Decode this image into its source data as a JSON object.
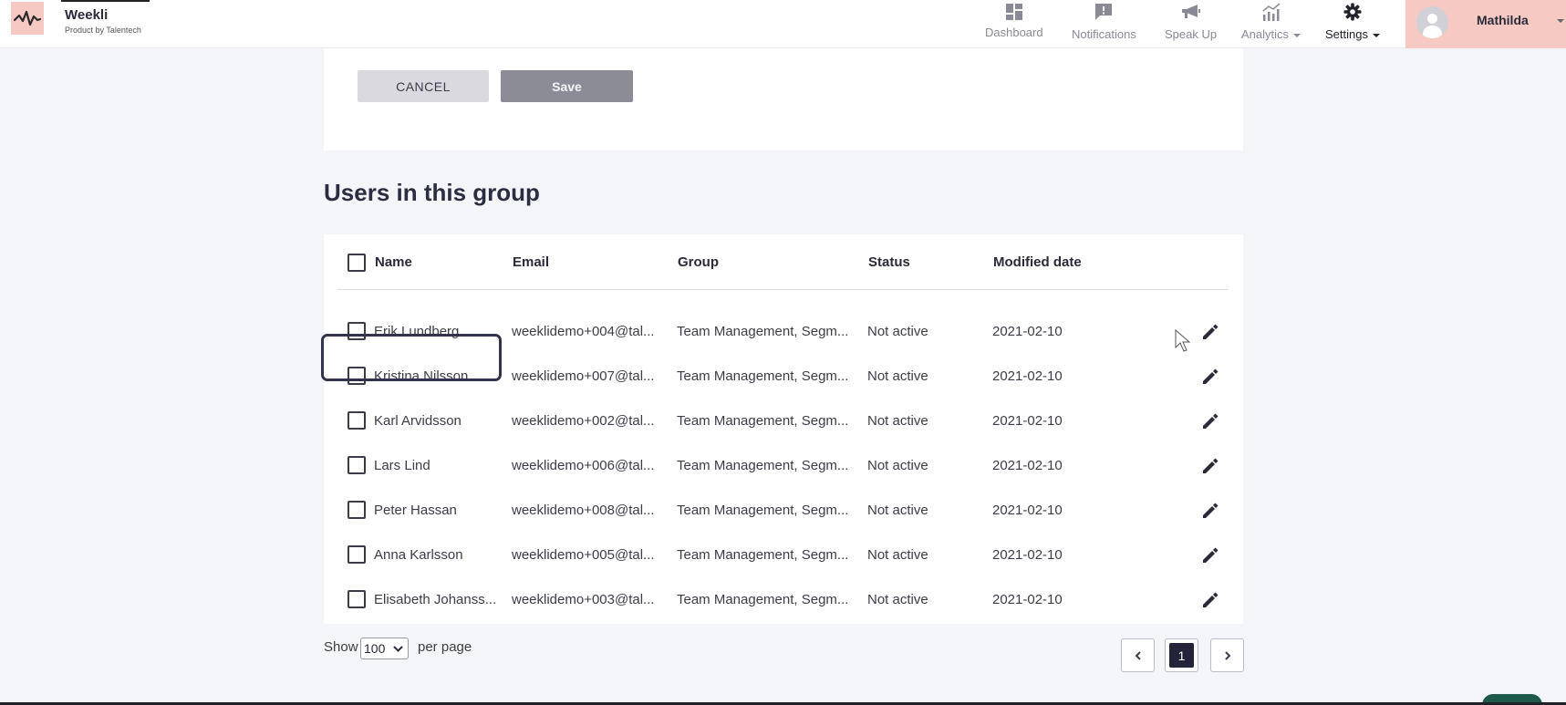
{
  "app": {
    "name": "Weekli",
    "subtitle": "Product by Talentech"
  },
  "nav": {
    "dashboard": "Dashboard",
    "notifications": "Notifications",
    "speakup": "Speak Up",
    "analytics": "Analytics",
    "settings": "Settings"
  },
  "user": {
    "name": "Mathilda"
  },
  "form": {
    "cancel_label": "CANCEL",
    "save_label": "Save"
  },
  "section": {
    "title": "Users in this group"
  },
  "table": {
    "columns": {
      "name": "Name",
      "email": "Email",
      "group": "Group",
      "status": "Status",
      "modified": "Modified date"
    },
    "rows": [
      {
        "name": "Erik Lundberg",
        "email": "weeklidemo+004@tal...",
        "group": "Team Management, Segm...",
        "status": "Not active",
        "modified": "2021-02-10"
      },
      {
        "name": "Kristina Nilsson",
        "email": "weeklidemo+007@tal...",
        "group": "Team Management, Segm...",
        "status": "Not active",
        "modified": "2021-02-10"
      },
      {
        "name": "Karl Arvidsson",
        "email": "weeklidemo+002@tal...",
        "group": "Team Management, Segm...",
        "status": "Not active",
        "modified": "2021-02-10"
      },
      {
        "name": "Lars Lind",
        "email": "weeklidemo+006@tal...",
        "group": "Team Management, Segm...",
        "status": "Not active",
        "modified": "2021-02-10"
      },
      {
        "name": "Peter Hassan",
        "email": "weeklidemo+008@tal...",
        "group": "Team Management, Segm...",
        "status": "Not active",
        "modified": "2021-02-10"
      },
      {
        "name": "Anna Karlsson",
        "email": "weeklidemo+005@tal...",
        "group": "Team Management, Segm...",
        "status": "Not active",
        "modified": "2021-02-10"
      },
      {
        "name": "Elisabeth Johanss...",
        "email": "weeklidemo+003@tal...",
        "group": "Team Management, Segm...",
        "status": "Not active",
        "modified": "2021-02-10"
      }
    ]
  },
  "pagination": {
    "show_label": "Show",
    "per_page_value": "100",
    "per_page_label": "per page",
    "current_page": "1"
  },
  "colors": {
    "brand_pink": "#f6c9c3",
    "dark_navy": "#23233a",
    "save_gray": "#8c8c96"
  },
  "icons": [
    "logo-wave-icon",
    "dashboard-icon",
    "notifications-icon",
    "megaphone-icon",
    "analytics-icon",
    "gear-icon",
    "user-avatar-icon",
    "pencil-icon",
    "chevron-left-icon",
    "chevron-right-icon",
    "chevron-down-icon"
  ]
}
